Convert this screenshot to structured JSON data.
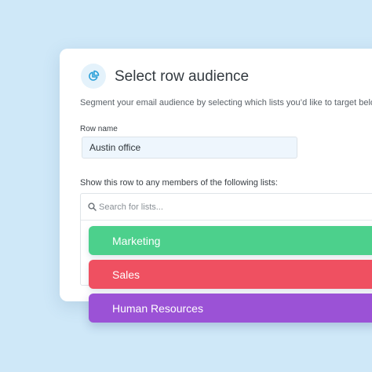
{
  "dialog": {
    "icon": "pie-chart-icon",
    "title": "Select row audience",
    "subtitle": "Segment your email audience by selecting which lists you’d like to target below."
  },
  "row_name": {
    "label": "Row name",
    "value": "Austin office"
  },
  "lists": {
    "label": "Show this row to any members of the following lists:",
    "search": {
      "icon": "search-icon",
      "placeholder": "Search for lists..."
    },
    "items": [
      {
        "label": "Marketing",
        "color": "#4cd08c"
      },
      {
        "label": "Sales",
        "color": "#ef5061"
      },
      {
        "label": "Human Resources",
        "color": "#9b52d6"
      }
    ]
  },
  "colors": {
    "background": "#cfe8f8",
    "accent": "#2a9fd8"
  }
}
